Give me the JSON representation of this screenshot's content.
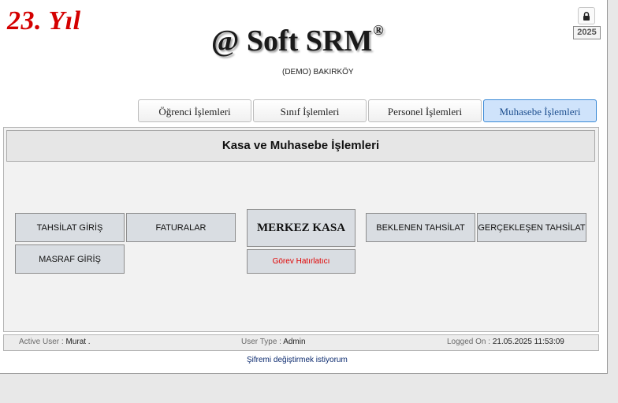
{
  "header": {
    "anniversary": "23. Yıl",
    "brand": "@ Soft SRM",
    "registered": "®",
    "branch": "(DEMO) BAKIRKÖY",
    "lock_icon": "lock-icon",
    "year_badge": "2025"
  },
  "tabs": [
    {
      "label": "Öğrenci İşlemleri",
      "active": false
    },
    {
      "label": "Sınıf İşlemleri",
      "active": false
    },
    {
      "label": "Personel İşlemleri",
      "active": false
    },
    {
      "label": "Muhasebe İşlemleri",
      "active": true
    }
  ],
  "panel": {
    "title": "Kasa ve Muhasebe İşlemleri",
    "buttons": {
      "tahsilat_giris": "TAHSİLAT GİRİŞ",
      "faturalar": "FATURALAR",
      "masraf_giris": "MASRAF GİRİŞ",
      "merkez_kasa": "MERKEZ KASA",
      "gorev_hatirlatici": "Görev Hatırlatıcı",
      "beklenen_tahsilat": "BEKLENEN TAHSİLAT",
      "gerceklesen_tahsilat": "GERÇEKLEŞEN TAHSİLAT"
    }
  },
  "status": {
    "active_user_label": "Active User :",
    "active_user": "Murat .",
    "user_type_label": "User Type :",
    "user_type": "Admin",
    "logged_on_label": "Logged On :",
    "logged_on": "21.05.2025 11:53:09"
  },
  "footer": {
    "change_password": "Şifremi değiştirmek istiyorum"
  },
  "colors": {
    "anniversary": "#d40000",
    "active_tab_bg": "#cfe3fb",
    "active_tab_border": "#3a89d6",
    "button_bg": "#d9dde2",
    "reminder_text": "#e00000",
    "link": "#0b2a6e"
  }
}
